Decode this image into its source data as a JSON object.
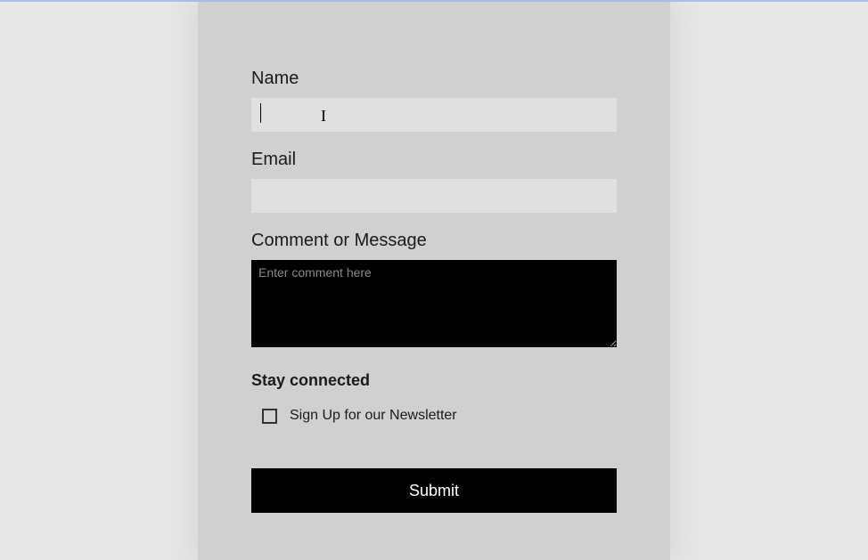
{
  "form": {
    "name_label": "Name",
    "name_value": "",
    "email_label": "Email",
    "email_value": "",
    "comment_label": "Comment or Message",
    "comment_placeholder": "Enter comment here",
    "comment_value": "",
    "stay_connected_heading": "Stay connected",
    "newsletter_label": "Sign Up for our Newsletter",
    "newsletter_checked": false,
    "submit_label": "Submit"
  }
}
